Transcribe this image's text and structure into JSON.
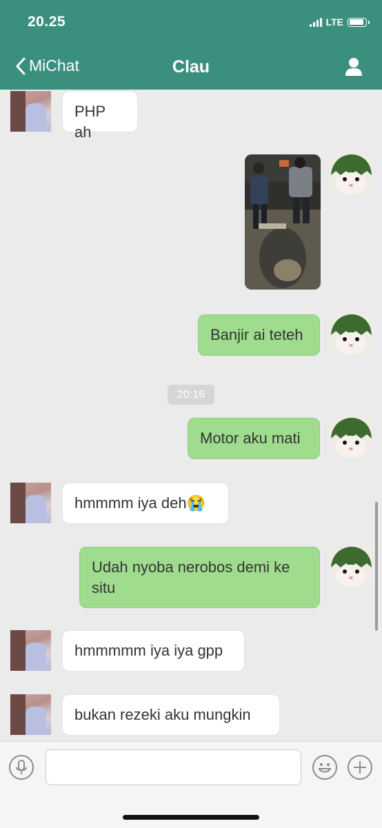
{
  "status_bar": {
    "time": "20.25",
    "network": "LTE"
  },
  "header": {
    "back_label": "MiChat",
    "title": "Clau"
  },
  "messages": [
    {
      "side": "in",
      "text": "PHP ah"
    },
    {
      "side": "out",
      "type": "image"
    },
    {
      "side": "out",
      "text": "Banjir ai teteh"
    },
    {
      "type": "timestamp",
      "text": "20:16"
    },
    {
      "side": "out",
      "text": "Motor aku mati"
    },
    {
      "side": "in",
      "text": "hmmmm iya deh😭"
    },
    {
      "side": "out",
      "text": "Udah nyoba nerobos demi ke situ"
    },
    {
      "side": "in",
      "text": "hmmmmm iya iya gpp"
    },
    {
      "side": "in",
      "text": "bukan rezeki aku mungkin"
    }
  ],
  "composer": {
    "value": "",
    "placeholder": ""
  },
  "colors": {
    "header": "#3b8f7f",
    "outgoing_bubble": "#9fdc8e",
    "incoming_bubble": "#ffffff",
    "background": "#ebebeb"
  }
}
